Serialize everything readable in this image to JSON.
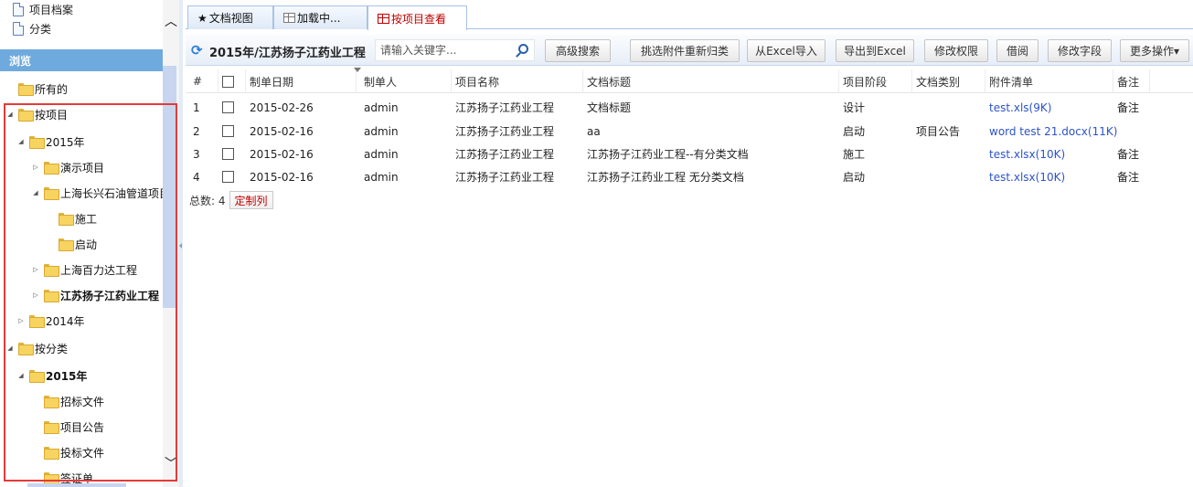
{
  "sidebar": {
    "top_items": [
      "项目档案",
      "分类"
    ],
    "browse_header": "浏览",
    "tree": [
      {
        "label": "所有的",
        "level": 0,
        "expander": "none",
        "bold": false
      },
      {
        "label": "按项目",
        "level": 0,
        "expander": "expanded",
        "bold": false
      },
      {
        "label": "2015年",
        "level": 1,
        "expander": "expanded",
        "bold": false
      },
      {
        "label": "演示项目",
        "level": 2,
        "expander": "collapsed",
        "bold": false
      },
      {
        "label": "上海长兴石油管道项目",
        "level": 2,
        "expander": "expanded",
        "bold": false
      },
      {
        "label": "施工",
        "level": 3,
        "expander": "none",
        "bold": false
      },
      {
        "label": "启动",
        "level": 3,
        "expander": "none",
        "bold": false
      },
      {
        "label": "上海百力达工程",
        "level": 2,
        "expander": "collapsed",
        "bold": false
      },
      {
        "label": "江苏扬子江药业工程",
        "level": 2,
        "expander": "collapsed",
        "bold": true
      },
      {
        "label": "2014年",
        "level": 1,
        "expander": "collapsed",
        "bold": false
      },
      {
        "label": "按分类",
        "level": 0,
        "expander": "expanded",
        "bold": false
      },
      {
        "label": "2015年",
        "level": 1,
        "expander": "expanded",
        "bold": true
      },
      {
        "label": "招标文件",
        "level": 2,
        "expander": "none",
        "bold": false
      },
      {
        "label": "项目公告",
        "level": 2,
        "expander": "none",
        "bold": false
      },
      {
        "label": "投标文件",
        "level": 2,
        "expander": "none",
        "bold": false
      },
      {
        "label": "签证单",
        "level": 2,
        "expander": "none",
        "bold": false
      }
    ]
  },
  "tabs": [
    {
      "label": "文档视图",
      "icon": "star-icon",
      "active": false
    },
    {
      "label": "加载中...",
      "icon": "grid-icon",
      "active": false
    },
    {
      "label": "按项目查看",
      "icon": "grid-icon",
      "active": true
    }
  ],
  "toolbar": {
    "title": "2015年/江苏扬子江药业工程",
    "search_placeholder": "请输入关键字...",
    "buttons": [
      "高级搜索",
      "挑选附件重新归类",
      "从Excel导入",
      "导出到Excel",
      "修改权限",
      "借阅",
      "修改字段",
      "更多操作▾"
    ]
  },
  "table": {
    "columns": [
      "#",
      "",
      "制单日期",
      "制单人",
      "项目名称",
      "文档标题",
      "项目阶段",
      "文档类别",
      "附件清单",
      "备注"
    ],
    "rows": [
      {
        "num": "1",
        "date": "2015-02-26",
        "creator": "admin",
        "project": "江苏扬子江药业工程",
        "title": "文档标题",
        "stage": "设计",
        "category": "",
        "attachment": "test.xls(9K)",
        "remark": "备注"
      },
      {
        "num": "2",
        "date": "2015-02-16",
        "creator": "admin",
        "project": "江苏扬子江药业工程",
        "title": "aa",
        "stage": "启动",
        "category": "项目公告",
        "attachment": "word test 21.docx(11K)",
        "remark": ""
      },
      {
        "num": "3",
        "date": "2015-02-16",
        "creator": "admin",
        "project": "江苏扬子江药业工程",
        "title": "江苏扬子江药业工程--有分类文档",
        "stage": "施工",
        "category": "",
        "attachment": "test.xlsx(10K)",
        "remark": "备注"
      },
      {
        "num": "4",
        "date": "2015-02-16",
        "creator": "admin",
        "project": "江苏扬子江药业工程",
        "title": "江苏扬子江药业工程 无分类文档",
        "stage": "启动",
        "category": "",
        "attachment": "test.xlsx(10K)",
        "remark": "备注"
      }
    ]
  },
  "footer": {
    "total_label": "总数: 4",
    "custom_columns_label": "定制列"
  },
  "colors": {
    "accent": "#6eaadd",
    "active_tab_text": "#c00000",
    "link": "#2c53c7",
    "highlight_frame": "#e53a3a"
  }
}
